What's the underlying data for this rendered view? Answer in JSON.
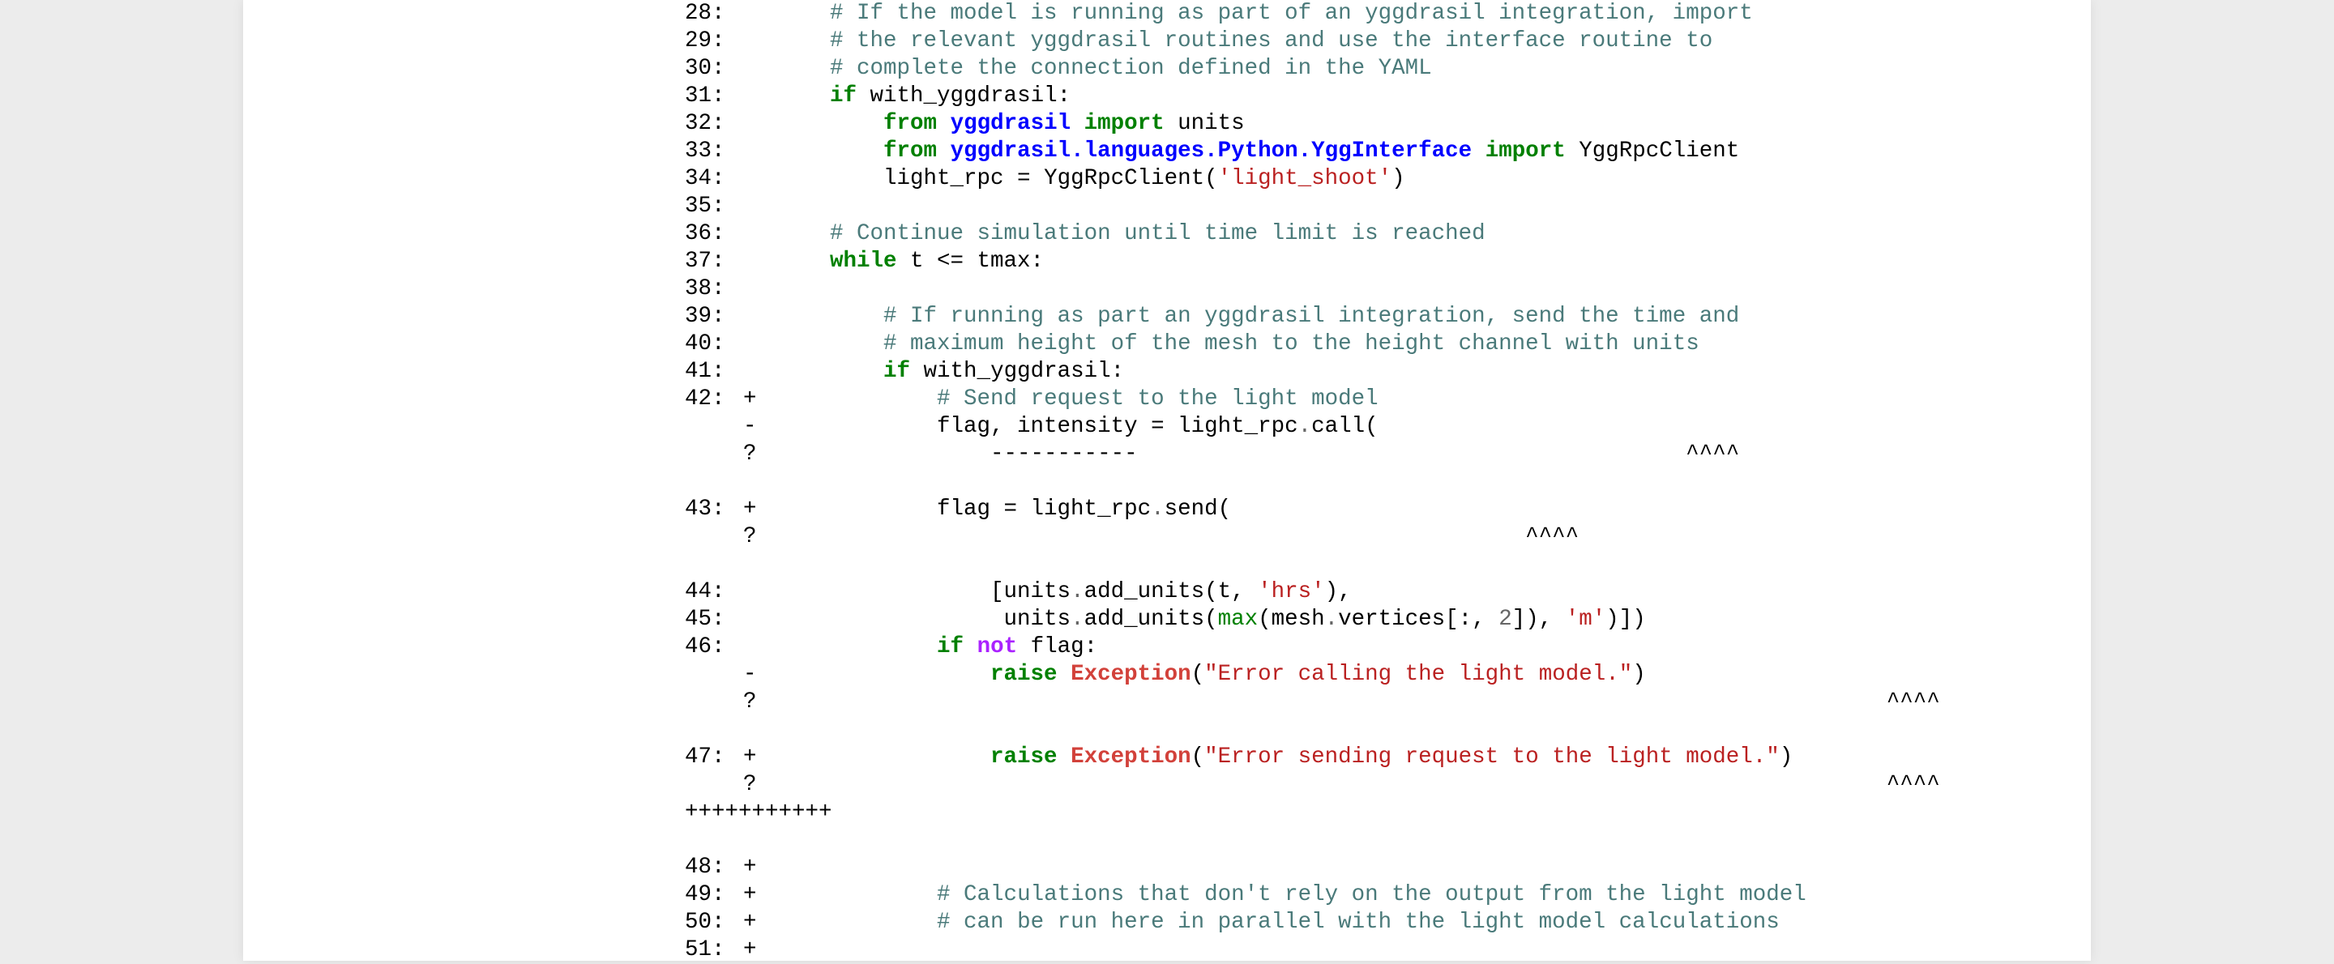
{
  "page": {
    "background": "#ececec",
    "panel": "#ffffff"
  },
  "colors": {
    "comment": "#4a7a7a",
    "keyword": "#008000",
    "namespace": "#0000ff",
    "string": "#ba2121",
    "exception": "#d2413a",
    "operator_word": "#aa22ff"
  },
  "lines": [
    {
      "num": "28:",
      "mark": "",
      "tokens": [
        [
          "    ",
          ""
        ],
        [
          "# If the model is running as part of an yggdrasil integration, import",
          "cm"
        ]
      ]
    },
    {
      "num": "29:",
      "mark": "",
      "tokens": [
        [
          "    ",
          ""
        ],
        [
          "# the relevant yggdrasil routines and use the interface routine to",
          "cm"
        ]
      ]
    },
    {
      "num": "30:",
      "mark": "",
      "tokens": [
        [
          "    ",
          ""
        ],
        [
          "# complete the connection defined in the YAML",
          "cm"
        ]
      ]
    },
    {
      "num": "31:",
      "mark": "",
      "tokens": [
        [
          "    ",
          ""
        ],
        [
          "if",
          "kw"
        ],
        [
          " with_yggdrasil:",
          ""
        ]
      ]
    },
    {
      "num": "32:",
      "mark": "",
      "tokens": [
        [
          "        ",
          ""
        ],
        [
          "from",
          "kw"
        ],
        [
          " ",
          ""
        ],
        [
          "yggdrasil",
          "nn"
        ],
        [
          " ",
          ""
        ],
        [
          "import",
          "kw"
        ],
        [
          " units",
          ""
        ]
      ]
    },
    {
      "num": "33:",
      "mark": "",
      "tokens": [
        [
          "        ",
          ""
        ],
        [
          "from",
          "kw"
        ],
        [
          " ",
          ""
        ],
        [
          "yggdrasil.languages.Python.YggInterface",
          "nn"
        ],
        [
          " ",
          ""
        ],
        [
          "import",
          "kw"
        ],
        [
          " YggRpcClient",
          ""
        ]
      ]
    },
    {
      "num": "34:",
      "mark": "",
      "tokens": [
        [
          "        ",
          ""
        ],
        [
          "light_rpc = YggRpcClient(",
          ""
        ],
        [
          "'light_shoot'",
          "st"
        ],
        [
          ")",
          ""
        ]
      ]
    },
    {
      "num": "35:",
      "mark": "",
      "tokens": []
    },
    {
      "num": "36:",
      "mark": "",
      "tokens": [
        [
          "    ",
          ""
        ],
        [
          "# Continue simulation until time limit is reached",
          "cm"
        ]
      ]
    },
    {
      "num": "37:",
      "mark": "",
      "tokens": [
        [
          "    ",
          ""
        ],
        [
          "while",
          "kw"
        ],
        [
          " t <= tmax:",
          ""
        ]
      ]
    },
    {
      "num": "38:",
      "mark": "",
      "tokens": []
    },
    {
      "num": "39:",
      "mark": "",
      "tokens": [
        [
          "        ",
          ""
        ],
        [
          "# If running as part an yggdrasil integration, send the time and",
          "cm"
        ]
      ]
    },
    {
      "num": "40:",
      "mark": "",
      "tokens": [
        [
          "        ",
          ""
        ],
        [
          "# maximum height of the mesh to the height channel with units",
          "cm"
        ]
      ]
    },
    {
      "num": "41:",
      "mark": "",
      "tokens": [
        [
          "        ",
          ""
        ],
        [
          "if",
          "kw"
        ],
        [
          " with_yggdrasil:",
          ""
        ]
      ]
    },
    {
      "num": "42:",
      "mark": "+",
      "tokens": [
        [
          "            ",
          ""
        ],
        [
          "# Send request to the light model",
          "cm"
        ]
      ]
    },
    {
      "num": "",
      "mark": "-",
      "tokens": [
        [
          "            flag, intensity = light_rpc",
          ""
        ],
        [
          ".",
          "op"
        ],
        [
          "call(",
          ""
        ]
      ]
    },
    {
      "num": "",
      "mark": "?",
      "tokens": [
        [
          "                -----------                                         ^^^^",
          ""
        ]
      ]
    },
    {
      "num": "",
      "mark": "",
      "tokens": []
    },
    {
      "num": "43:",
      "mark": "+",
      "tokens": [
        [
          "            flag = light_rpc",
          ""
        ],
        [
          ".",
          "op"
        ],
        [
          "send(",
          ""
        ]
      ]
    },
    {
      "num": "",
      "mark": "?",
      "tokens": [
        [
          "                                                        ^^^^",
          ""
        ]
      ]
    },
    {
      "num": "",
      "mark": "",
      "tokens": []
    },
    {
      "num": "44:",
      "mark": "",
      "tokens": [
        [
          "                [units",
          ""
        ],
        [
          ".",
          "op"
        ],
        [
          "add_units(t, ",
          ""
        ],
        [
          "'hrs'",
          "st"
        ],
        [
          "),",
          ""
        ]
      ]
    },
    {
      "num": "45:",
      "mark": "",
      "tokens": [
        [
          "                 units",
          ""
        ],
        [
          ".",
          "op"
        ],
        [
          "add_units(",
          ""
        ],
        [
          "max",
          "nb"
        ],
        [
          "(mesh",
          ""
        ],
        [
          ".",
          "op"
        ],
        [
          "vertices[:, ",
          ""
        ],
        [
          "2",
          "ni"
        ],
        [
          "]), ",
          ""
        ],
        [
          "'m'",
          "st"
        ],
        [
          ")])",
          ""
        ]
      ]
    },
    {
      "num": "46:",
      "mark": "",
      "tokens": [
        [
          "            ",
          ""
        ],
        [
          "if",
          "kw"
        ],
        [
          " ",
          ""
        ],
        [
          "not",
          "ow"
        ],
        [
          " flag:",
          ""
        ]
      ]
    },
    {
      "num": "",
      "mark": "-",
      "tokens": [
        [
          "                ",
          ""
        ],
        [
          "raise",
          "kw"
        ],
        [
          " ",
          ""
        ],
        [
          "Exception",
          "ne"
        ],
        [
          "(",
          ""
        ],
        [
          "\"Error calling the light model.\"",
          "st"
        ],
        [
          ")",
          ""
        ]
      ]
    },
    {
      "num": "",
      "mark": "?",
      "tokens": [
        [
          "                                                                                   ^^^^",
          ""
        ]
      ]
    },
    {
      "num": "",
      "mark": "",
      "tokens": []
    },
    {
      "num": "47:",
      "mark": "+",
      "tokens": [
        [
          "                ",
          ""
        ],
        [
          "raise",
          "kw"
        ],
        [
          " ",
          ""
        ],
        [
          "Exception",
          "ne"
        ],
        [
          "(",
          ""
        ],
        [
          "\"Error sending request to the light model.\"",
          "st"
        ],
        [
          ")",
          ""
        ]
      ]
    },
    {
      "num": "",
      "mark": "?",
      "tokens": [
        [
          "                                                                                   ^^^^",
          ""
        ]
      ]
    },
    {
      "num": "+++++++++++",
      "mark": "",
      "tokens": []
    },
    {
      "num": "",
      "mark": "",
      "tokens": []
    },
    {
      "num": "48:",
      "mark": "+",
      "tokens": []
    },
    {
      "num": "49:",
      "mark": "+",
      "tokens": [
        [
          "            ",
          ""
        ],
        [
          "# Calculations that don't rely on the output from the light model",
          "cm"
        ]
      ]
    },
    {
      "num": "50:",
      "mark": "+",
      "tokens": [
        [
          "            ",
          ""
        ],
        [
          "# can be run here in parallel with the light model calculations",
          "cm"
        ]
      ]
    },
    {
      "num": "51:",
      "mark": "+",
      "tokens": []
    }
  ]
}
